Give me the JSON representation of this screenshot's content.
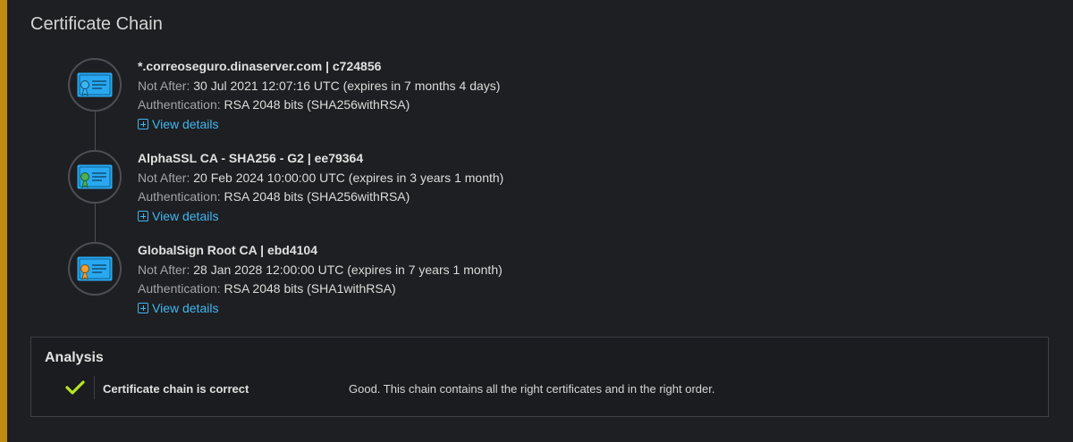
{
  "page": {
    "title": "Certificate Chain"
  },
  "certificates": [
    {
      "name": "*.correoseguro.dinaserver.com | c724856",
      "not_after_label": "Not After:",
      "not_after_value": "30 Jul 2021 12:07:16 UTC (expires in 7 months 4 days)",
      "auth_label": "Authentication:",
      "auth_value": "RSA 2048 bits (SHA256withRSA)",
      "details_label": "View details",
      "icon": "certificate-icon",
      "ribbon_color": "#41b5f0"
    },
    {
      "name": "AlphaSSL CA - SHA256 - G2 | ee79364",
      "not_after_label": "Not After:",
      "not_after_value": "20 Feb 2024 10:00:00 UTC (expires in 3 years 1 month)",
      "auth_label": "Authentication:",
      "auth_value": "RSA 2048 bits (SHA256withRSA)",
      "details_label": "View details",
      "icon": "certificate-icon",
      "ribbon_color": "#4caf50"
    },
    {
      "name": "GlobalSign Root CA | ebd4104",
      "not_after_label": "Not After:",
      "not_after_value": "28 Jan 2028 12:00:00 UTC (expires in 7 years 1 month)",
      "auth_label": "Authentication:",
      "auth_value": "RSA 2048 bits (SHA1withRSA)",
      "details_label": "View details",
      "icon": "certificate-icon",
      "ribbon_color": "#f0a030"
    }
  ],
  "analysis": {
    "title": "Analysis",
    "items": [
      {
        "icon": "checkmark-icon",
        "status_color": "#b6e61e",
        "label": "Certificate chain is correct",
        "description": "Good. This chain contains all the right certificates and in the right order."
      }
    ]
  },
  "colors": {
    "accent": "#c08a12",
    "link": "#41b5f0",
    "certificate_card": "#29a8f0"
  }
}
